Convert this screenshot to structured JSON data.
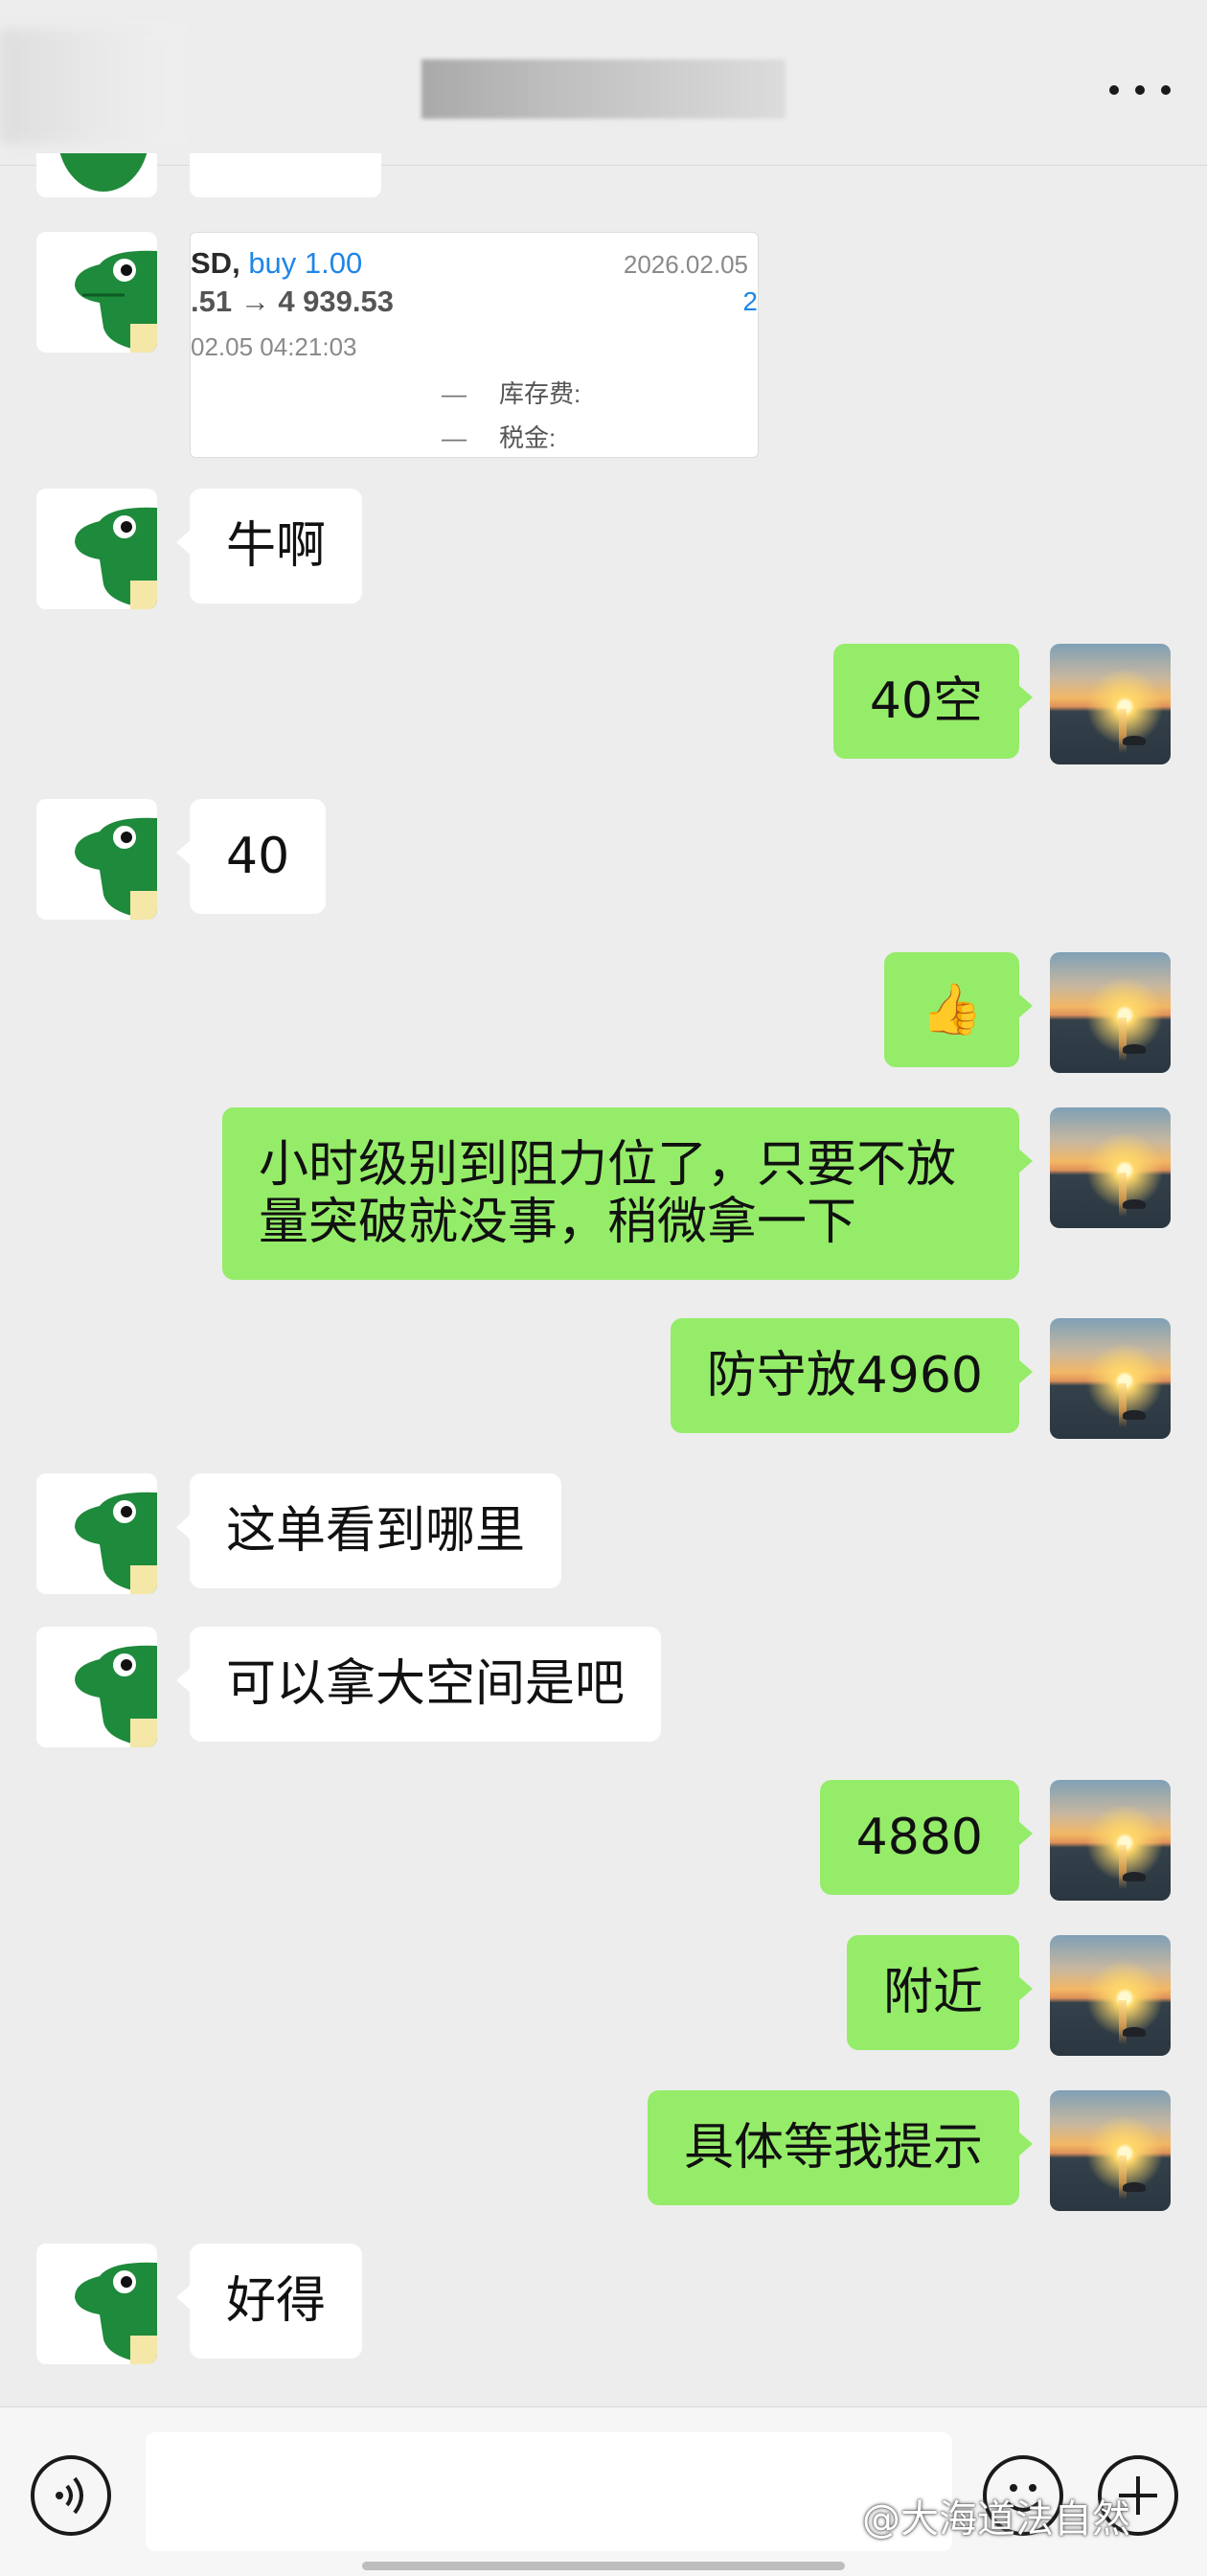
{
  "header": {
    "title": "",
    "more_icon": "more-dots-icon"
  },
  "trade_card": {
    "symbol": "SD,",
    "side": "buy 1.00",
    "date": "2026.02.05",
    "price_change": ".51 → 4 939.53",
    "right_digit": "2",
    "time": "02.05 04:21:03",
    "fee_dash": "—",
    "fee_label": "库存费:",
    "tax_label": "税金:"
  },
  "messages": [
    {
      "side": "left",
      "text": "牛啊"
    },
    {
      "side": "right",
      "text": "40空"
    },
    {
      "side": "left",
      "text": "40"
    },
    {
      "side": "right",
      "text": "👍"
    },
    {
      "side": "right",
      "text": "小时级别到阻力位了，只要不放量突破就没事，稍微拿一下"
    },
    {
      "side": "right",
      "text": "防守放4960"
    },
    {
      "side": "left",
      "text": "这单看到哪里"
    },
    {
      "side": "left",
      "text": "可以拿大空间是吧"
    },
    {
      "side": "right",
      "text": "4880"
    },
    {
      "side": "right",
      "text": "附近"
    },
    {
      "side": "right",
      "text": "具体等我提示"
    },
    {
      "side": "left",
      "text": "好得"
    }
  ],
  "input_bar": {
    "placeholder": "",
    "watermark": "@大海道法自然",
    "voice_icon": "voice-icon",
    "emoji_icon": "emoji-icon",
    "plus_icon": "plus-icon"
  },
  "colors": {
    "bubble_right": "#95ec69",
    "bubble_left": "#ffffff",
    "background": "#ededed",
    "link_blue": "#1e86e6"
  }
}
